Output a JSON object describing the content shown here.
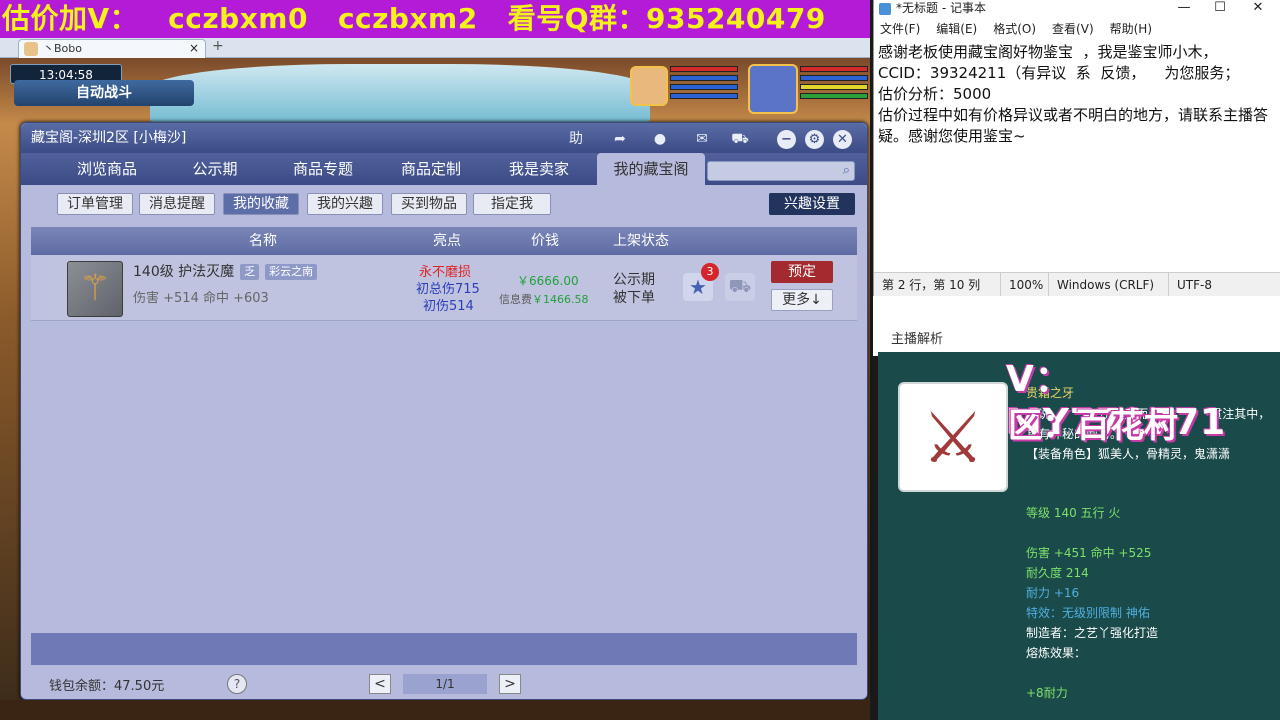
{
  "banner": {
    "text1": "估价加V：",
    "text2": "cczbxm0",
    "text3": "cczbxm2",
    "text4": "看号Q群：935240479"
  },
  "browser": {
    "tab_title": "丶Bobo",
    "close": "×",
    "new_tab": "+"
  },
  "game": {
    "clock": "13:04:58",
    "auto_battle": "自动战斗"
  },
  "dialog": {
    "title": "藏宝阁-深圳2区 [小梅沙]",
    "help": "助",
    "tabs": [
      "浏览商品",
      "公示期",
      "商品专题",
      "商品定制",
      "我是卖家",
      "我的藏宝阁"
    ],
    "search_icon": "search-icon",
    "subtabs": [
      "订单管理",
      "消息提醒",
      "我的收藏",
      "我的兴趣",
      "买到物品",
      "指定我"
    ],
    "interest_settings": "兴趣设置",
    "columns": [
      "名称",
      "亮点",
      "价钱",
      "上架状态"
    ],
    "item": {
      "name": "140级 护法灭魔",
      "tag1": "乏",
      "tag2": "彩云之南",
      "stats": "伤害 +514 命中 +603",
      "highlight1": "永不磨损",
      "highlight2": "初总伤715",
      "highlight3": "初伤514",
      "price": "￥6666.00",
      "fee_label": "信息费",
      "fee_value": "￥1466.58",
      "status1": "公示期",
      "status2": "被下单",
      "fav_count": "3",
      "reserve": "预定",
      "more": "更多↓"
    },
    "wallet": "钱包余额：47.50元",
    "help_icon": "?",
    "prev": "<",
    "page": "1/1",
    "next": ">"
  },
  "notepad": {
    "title": "*无标题 - 记事本",
    "menu": [
      "文件(F)",
      "编辑(E)",
      "格式(O)",
      "查看(V)",
      "帮助(H)"
    ],
    "controls": [
      "—",
      "☐",
      "✕"
    ],
    "content": "感谢老板使用藏宝阁好物鉴宝  ，我是鉴宝师小木，\nCCID：39324211（有异议  系  反馈，    为您服务；\n估价分析：5000\n估价过程中如有价格异议或者不明白的地方，请联系主播答疑。感谢您使用鉴宝~",
    "status": {
      "pos": "第 2 行，第 10 列",
      "zoom": "100%",
      "eol": "Windows (CRLF)",
      "enc": "UTF-8"
    }
  },
  "right_panel": {
    "subtitle": "主播解析",
    "watermark1": "V：MY771771",
    "watermark2": "区：百花村",
    "item_name": "贵霜之牙",
    "desc": "传说          牙所雕刻而成。          贯注其中，具有神秘的威力。\n【装备角色】狐美人，骨精灵，鬼潇潇",
    "level": "等级 140 五行 火",
    "dmg": "伤害 +451 命中 +525",
    "durability": "耐久度 214",
    "endurance": "耐力 +16",
    "effect": "特效：无级别限制 神佑",
    "maker": "制造者：之艺丫强化打造",
    "refine": "熔炼效果：",
    "refine_val": "+8耐力"
  }
}
